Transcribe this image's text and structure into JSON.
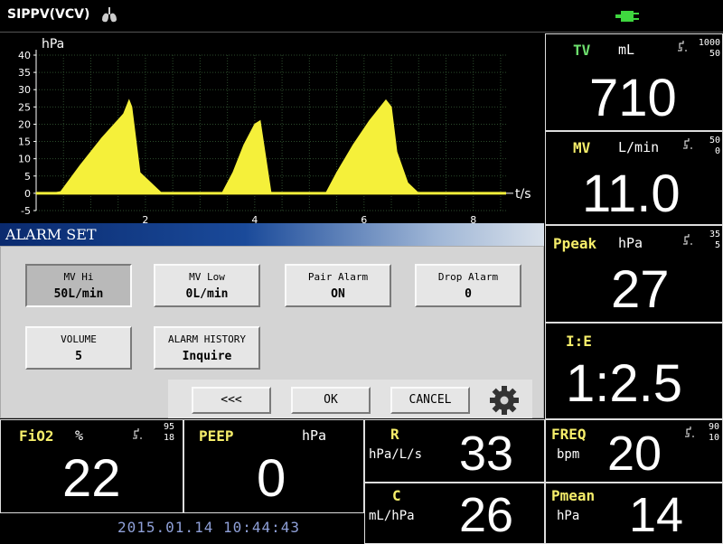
{
  "header": {
    "mode": "SIPPV(VCV)",
    "lungs_icon": "lungs-icon",
    "power_icon": "plug-icon",
    "power_color": "#3fd63f"
  },
  "waveform": {
    "unit": "hPa",
    "y_ticks": [
      "40",
      "35",
      "30",
      "25",
      "20",
      "15",
      "10",
      "5",
      "0",
      "-5"
    ],
    "x_ticks": [
      "2",
      "4",
      "6",
      "8"
    ],
    "x_unit": "t/s",
    "color": "#f5f03a"
  },
  "chart_data": {
    "type": "area",
    "ylabel": "hPa",
    "xlabel": "t/s",
    "ylim": [
      -5,
      40
    ],
    "xlim": [
      0,
      8.6
    ],
    "x": [
      0,
      0.3,
      0.45,
      0.8,
      1.2,
      1.6,
      1.7,
      1.75,
      1.9,
      2.3,
      3.4,
      3.6,
      3.8,
      4.0,
      4.1,
      4.3,
      5.3,
      5.5,
      5.8,
      6.1,
      6.4,
      6.5,
      6.6,
      6.8,
      7.0,
      7.5,
      8.5
    ],
    "values": [
      0,
      0,
      0.5,
      8,
      16,
      23,
      27,
      25,
      6,
      0,
      0,
      6,
      14,
      20,
      21,
      0,
      0,
      6,
      14,
      21,
      27,
      25,
      12,
      3,
      0,
      0,
      0
    ]
  },
  "params": {
    "tv": {
      "label": "TV",
      "unit": "mL",
      "value": "710",
      "hi": "1000",
      "lo": "50"
    },
    "mv": {
      "label": "MV",
      "unit": "L/min",
      "value": "11.0",
      "hi": "50",
      "lo": "0"
    },
    "ppeak": {
      "label": "Ppeak",
      "unit": "hPa",
      "value": "27",
      "hi": "35",
      "lo": "5"
    },
    "ie": {
      "label": "I:E",
      "value": "1:2.5"
    },
    "fio2": {
      "label": "FiO2",
      "unit": "%",
      "value": "22",
      "hi": "95",
      "lo": "18"
    },
    "peep": {
      "label": "PEEP",
      "unit": "hPa",
      "value": "0"
    },
    "r": {
      "label": "R",
      "unit": "hPa/L/s",
      "value": "33"
    },
    "c": {
      "label": "C",
      "unit": "mL/hPa",
      "value": "26"
    },
    "freq": {
      "label": "FREQ",
      "unit": "bpm",
      "value": "20",
      "hi": "90",
      "lo": "10"
    },
    "pmean": {
      "label": "Pmean",
      "unit": "hPa",
      "value": "14"
    }
  },
  "alarm_set": {
    "title": "ALARM SET",
    "buttons": [
      {
        "label": "MV Hi",
        "value": "50L/min"
      },
      {
        "label": "MV Low",
        "value": "0L/min"
      },
      {
        "label": "Pair Alarm",
        "value": "ON"
      },
      {
        "label": "Drop Alarm",
        "value": "0"
      },
      {
        "label": "VOLUME",
        "value": "5"
      },
      {
        "label": "ALARM HISTORY",
        "value": "Inquire"
      }
    ],
    "back_label": "<<<",
    "ok_label": "OK",
    "cancel_label": "CANCEL"
  },
  "datetime": "2015.01.14  10:44:43"
}
